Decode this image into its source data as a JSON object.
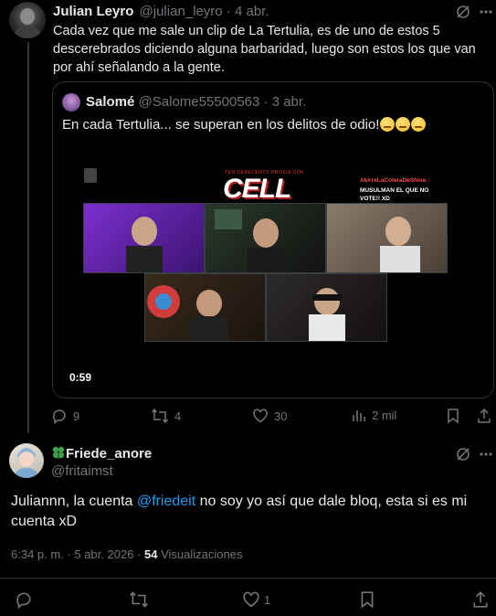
{
  "first_tweet": {
    "author_name": "Julian Leyro",
    "handle": "@julian_leyro",
    "separator": "·",
    "date": "4 abr.",
    "text": "Cada vez que me sale un clip de La Tertulia, es de uno de estos 5 descerebrados diciendo alguna barbaridad, luego son estos los que van por ahí señalando a la gente.",
    "icons": [
      "grok-icon",
      "more-icon"
    ],
    "quote": {
      "author_name": "Salomé",
      "handle": "@Salome55500563",
      "separator": "·",
      "date": "3 abr.",
      "text": "En cada Tertulia... se superan en los delitos de odio!",
      "video": {
        "duration": "0:59",
        "overlay_title": "CELL",
        "overlay_url": "TEN.DERECENTO.PROSIA.COM",
        "chat_user": "AkirreLaColeraDeShiva :",
        "chat_message": "MUSULMAN EL QUE NO VOTE!! XD"
      }
    },
    "stats": {
      "replies": "9",
      "retweets": "4",
      "likes": "30",
      "views": "2 mil"
    }
  },
  "reply": {
    "author_prefix_icon": "clover-icon",
    "author_name": "Friede_anore",
    "handle": "@fritaimst",
    "text_before": "Juliannn, la cuenta ",
    "mention": "@friedeit",
    "text_after": " no soy yo así que dale bloq, esta si es mi cuenta xD",
    "timestamp": "6:34 p. m. · 5 abr. 2026 ·",
    "views_count": "54",
    "views_label": "Visualizaciones",
    "stats": {
      "likes": "1"
    }
  },
  "colors": {
    "background": "#000000",
    "text": "#e7e9ea",
    "muted": "#71767b",
    "link": "#1d9bf0",
    "divider": "#2f3336"
  }
}
